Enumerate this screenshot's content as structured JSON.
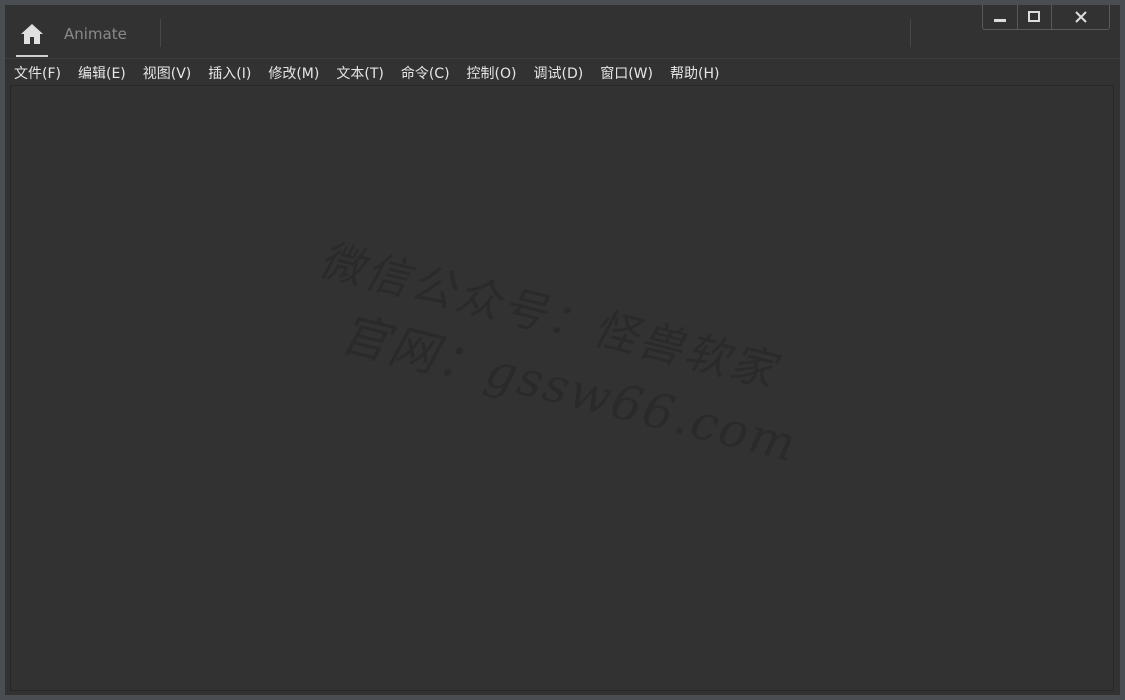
{
  "titlebar": {
    "home_icon": "home-icon",
    "app_tab_label": "Animate",
    "window_controls": {
      "minimize_icon": "minimize-icon",
      "maximize_icon": "maximize-icon",
      "close_icon": "close-icon"
    }
  },
  "menubar": {
    "items": [
      {
        "label": "文件(F)"
      },
      {
        "label": "编辑(E)"
      },
      {
        "label": "视图(V)"
      },
      {
        "label": "插入(I)"
      },
      {
        "label": "修改(M)"
      },
      {
        "label": "文本(T)"
      },
      {
        "label": "命令(C)"
      },
      {
        "label": "控制(O)"
      },
      {
        "label": "调试(D)"
      },
      {
        "label": "窗口(W)"
      },
      {
        "label": "帮助(H)"
      }
    ]
  },
  "watermark": {
    "line1": "微信公众号：怪兽软家",
    "line2": "官网：gssw66.com"
  },
  "colors": {
    "background": "#323232",
    "frame": "#4a4e52",
    "menu_text": "#e6e6e6",
    "tab_text": "#8a8a8a"
  }
}
